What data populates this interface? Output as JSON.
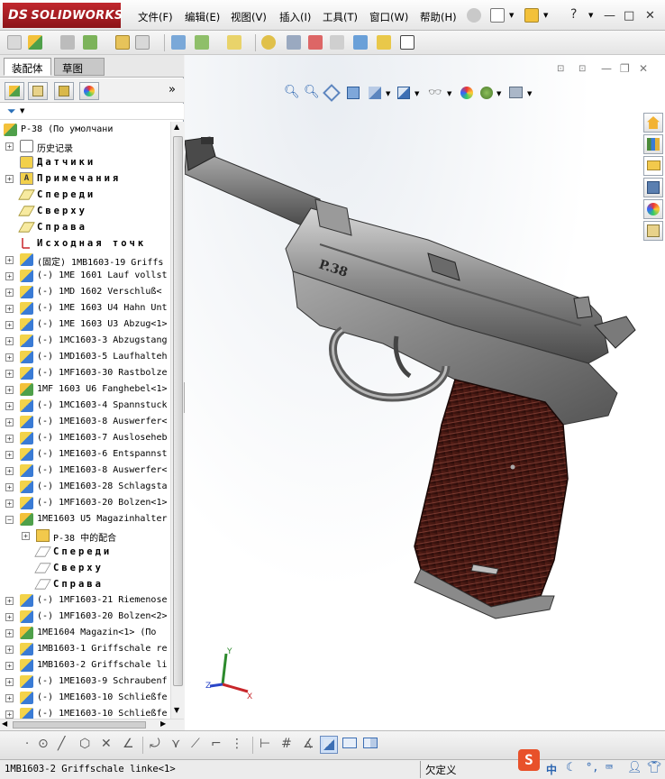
{
  "app": {
    "logo_prefix": "DS",
    "logo_text": "SOLIDWORKS",
    "menu": [
      {
        "id": "file",
        "label": "文件(F)"
      },
      {
        "id": "edit",
        "label": "编辑(E)"
      },
      {
        "id": "view",
        "label": "视图(V)"
      },
      {
        "id": "insert",
        "label": "插入(I)"
      },
      {
        "id": "tools",
        "label": "工具(T)"
      },
      {
        "id": "window",
        "label": "窗口(W)"
      },
      {
        "id": "help",
        "label": "帮助(H)"
      }
    ],
    "help_glyph": "?",
    "window_controls": [
      "—",
      "□",
      "✕"
    ]
  },
  "panel": {
    "tabs": [
      {
        "label": "装配体",
        "active": true
      },
      {
        "label": "草图",
        "active": false
      }
    ],
    "more_glyph": "»",
    "icons": [
      "featuremanager-icon",
      "propertymanager-icon",
      "configurationmanager-icon",
      "appearance-icon"
    ]
  },
  "tree": [
    {
      "level": 0,
      "expander": "",
      "icon": "asm",
      "label": "P-38  (По умолчани",
      "spaced": false
    },
    {
      "level": 1,
      "expander": "+",
      "icon": "hist",
      "label": "历史记录",
      "spaced": false
    },
    {
      "level": 1,
      "expander": "",
      "icon": "sensor",
      "label": "Датчики",
      "spaced": true
    },
    {
      "level": 1,
      "expander": "+",
      "icon": "note",
      "label": "Примечания",
      "spaced": true
    },
    {
      "level": 1,
      "expander": "",
      "icon": "plane",
      "label": "Спереди",
      "spaced": true
    },
    {
      "level": 1,
      "expander": "",
      "icon": "plane",
      "label": "Сверху",
      "spaced": true
    },
    {
      "level": 1,
      "expander": "",
      "icon": "plane",
      "label": "Справа",
      "spaced": true
    },
    {
      "level": 1,
      "expander": "",
      "icon": "origin",
      "label": "Исходная точк",
      "spaced": true
    },
    {
      "level": 1,
      "expander": "+",
      "icon": "part",
      "label": "(固定) 1MB1603-19 Griffs",
      "spaced": false
    },
    {
      "level": 1,
      "expander": "+",
      "icon": "part",
      "label": "(-) 1ME 1601 Lauf vollst",
      "spaced": false
    },
    {
      "level": 1,
      "expander": "+",
      "icon": "part",
      "label": "(-) 1MD 1602  Verschluß<",
      "spaced": false
    },
    {
      "level": 1,
      "expander": "+",
      "icon": "part",
      "label": "(-) 1ME 1603 U4 Hahn Unt",
      "spaced": false
    },
    {
      "level": 1,
      "expander": "+",
      "icon": "part",
      "label": "(-) 1ME 1603 U3 Abzug<1>",
      "spaced": false
    },
    {
      "level": 1,
      "expander": "+",
      "icon": "part",
      "label": "(-) 1MC1603-3 Abzugstang",
      "spaced": false
    },
    {
      "level": 1,
      "expander": "+",
      "icon": "part",
      "label": "(-) 1MD1603-5 Laufhalteh",
      "spaced": false
    },
    {
      "level": 1,
      "expander": "+",
      "icon": "part",
      "label": "(-) 1MF1603-30 Rastbolze",
      "spaced": false
    },
    {
      "level": 1,
      "expander": "+",
      "icon": "asm",
      "label": "1MF 1603 U6 Fanghebel<1>",
      "spaced": false
    },
    {
      "level": 1,
      "expander": "+",
      "icon": "part",
      "label": "(-) 1MC1603-4 Spannstuck",
      "spaced": false
    },
    {
      "level": 1,
      "expander": "+",
      "icon": "part",
      "label": "(-) 1ME1603-8 Auswerfer<",
      "spaced": false
    },
    {
      "level": 1,
      "expander": "+",
      "icon": "part",
      "label": "(-) 1ME1603-7 Ausloseheb",
      "spaced": false
    },
    {
      "level": 1,
      "expander": "+",
      "icon": "part",
      "label": "(-) 1ME1603-6 Entspannst",
      "spaced": false
    },
    {
      "level": 1,
      "expander": "+",
      "icon": "part",
      "label": "(-) 1ME1603-8 Auswerfer<",
      "spaced": false
    },
    {
      "level": 1,
      "expander": "+",
      "icon": "part",
      "label": "(-) 1ME1603-28 Schlagsta",
      "spaced": false
    },
    {
      "level": 1,
      "expander": "+",
      "icon": "part",
      "label": "(-) 1MF1603-20 Bolzen<1>",
      "spaced": false
    },
    {
      "level": 1,
      "expander": "−",
      "icon": "asm",
      "label": "1ME1603 U5 Magazinhalter",
      "spaced": false
    },
    {
      "level": 2,
      "expander": "+",
      "icon": "folder",
      "label": "P-38 中的配合",
      "spaced": false
    },
    {
      "level": 2,
      "expander": "",
      "icon": "planegrey",
      "label": "Спереди",
      "spaced": true
    },
    {
      "level": 2,
      "expander": "",
      "icon": "planegrey",
      "label": "Сверху",
      "spaced": true
    },
    {
      "level": 2,
      "expander": "",
      "icon": "planegrey",
      "label": "Справа",
      "spaced": true
    },
    {
      "level": 1,
      "expander": "+",
      "icon": "part",
      "label": "(-) 1MF1603-21 Riemenose",
      "spaced": false
    },
    {
      "level": 1,
      "expander": "+",
      "icon": "part",
      "label": "(-) 1MF1603-20 Bolzen<2>",
      "spaced": false
    },
    {
      "level": 1,
      "expander": "+",
      "icon": "asm",
      "label": "1ME1604 Magazin<1> (По",
      "spaced": false
    },
    {
      "level": 1,
      "expander": "+",
      "icon": "part",
      "label": "1MB1603-1 Griffschale re",
      "spaced": false
    },
    {
      "level": 1,
      "expander": "+",
      "icon": "part",
      "label": "1MB1603-2 Griffschale li",
      "spaced": false
    },
    {
      "level": 1,
      "expander": "+",
      "icon": "part",
      "label": "(-) 1ME1603-9 Schraubenf",
      "spaced": false
    },
    {
      "level": 1,
      "expander": "+",
      "icon": "part",
      "label": "(-) 1ME1603-10 Schließfe",
      "spaced": false
    },
    {
      "level": 1,
      "expander": "+",
      "icon": "part",
      "label": "(-) 1ME1603-10 Schließfe",
      "spaced": false
    }
  ],
  "model": {
    "slide_marking": "P.38",
    "triad_x": "X",
    "triad_y": "Y",
    "triad_z": "Z"
  },
  "status": {
    "selected_item": "1MB1603-2 Griffschale linke<1>",
    "state": "欠定义",
    "ime_label": "中"
  },
  "colors": {
    "logo_red": "#b01e24",
    "grip_brown": "#3a1410",
    "metal_grey": "#8a8a8a"
  }
}
